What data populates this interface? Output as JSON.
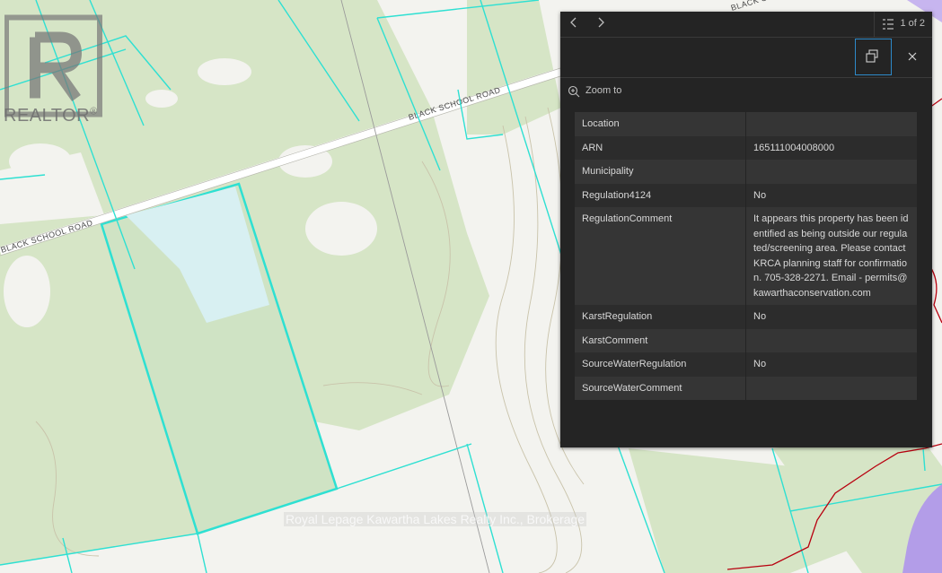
{
  "map": {
    "roads": [
      {
        "label": "BLACK SCHOOL ROAD"
      },
      {
        "label": "BLACK SCHOOL ROAD"
      },
      {
        "label": "BLACK SCHOOL ROAD"
      }
    ],
    "colors": {
      "parcel_line": "#2ee0d2",
      "land": "#d4e4c4",
      "water": "#d8f0f0",
      "contour": "#c8c2a8",
      "boundary": "#b8000f",
      "lake": "#b39de8"
    }
  },
  "logo": {
    "text": "REALTOR",
    "mark": "®"
  },
  "watermark": "Royal Lepage Kawartha Lakes Realty Inc., Brokerage",
  "popup": {
    "count_text": "1 of 2",
    "zoom_label": "Zoom to",
    "rows": [
      {
        "key": "Location",
        "value": ""
      },
      {
        "key": "ARN",
        "value": "165111004008000"
      },
      {
        "key": "Municipality",
        "value": ""
      },
      {
        "key": "Regulation4124",
        "value": "No"
      },
      {
        "key": "RegulationComment",
        "value": "It appears this property has been identified as being outside our regulated/screening area. Please contact KRCA planning staff for confirmation. 705-328-2271. Email - permits@kawarthaconservation.com"
      },
      {
        "key": "KarstRegulation",
        "value": "No"
      },
      {
        "key": "KarstComment",
        "value": ""
      },
      {
        "key": "SourceWaterRegulation",
        "value": "No"
      },
      {
        "key": "SourceWaterComment",
        "value": ""
      }
    ]
  }
}
